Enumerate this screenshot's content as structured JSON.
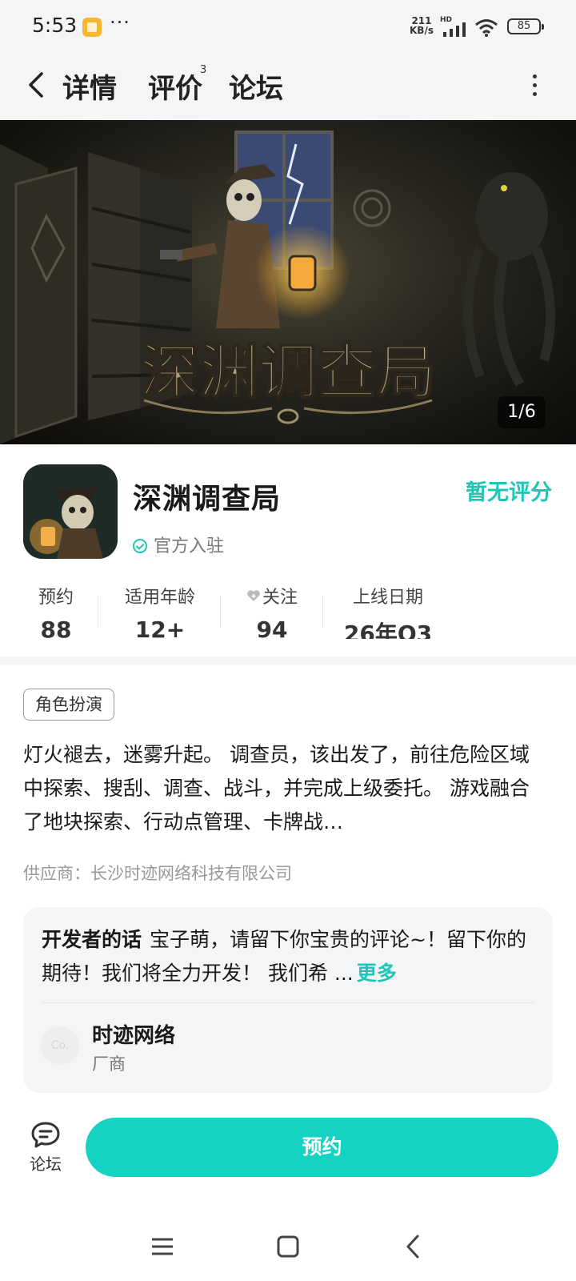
{
  "status_bar": {
    "time": "5:53",
    "dots": "···",
    "speed_value": "211",
    "speed_unit": "KB/s",
    "hd": "HD",
    "battery": "85"
  },
  "nav": {
    "tabs": [
      {
        "label": "详情",
        "active": true
      },
      {
        "label": "评价",
        "badge": "3"
      },
      {
        "label": "论坛"
      }
    ]
  },
  "banner": {
    "counter": "1/6",
    "art_title": "深渊调查局"
  },
  "game": {
    "title": "深渊调查局",
    "rating": "暂无评分",
    "verified_label": "官方入驻"
  },
  "stats": [
    {
      "label": "预约",
      "value": "88"
    },
    {
      "label": "适用年龄",
      "value": "12+"
    },
    {
      "label": "关注",
      "value": "94"
    },
    {
      "label": "上线日期",
      "value": "26年Q3"
    }
  ],
  "tag": "角色扮演",
  "description": "灯火褪去，迷雾升起。 调查员，该出发了，前往危险区域中探索、搜刮、调查、战斗，并完成上级委托。 游戏融合了地块探索、行动点管理、卡牌战…",
  "supplier": "供应商：长沙时迹网络科技有限公司",
  "developer": {
    "label": "开发者的话",
    "text": "宝子萌，请留下你宝贵的评论~！留下你的期待！我们将全力开发！ 我们希 ...",
    "more": "更多",
    "avatar_text": "Co.",
    "name": "时迹网络",
    "role": "厂商"
  },
  "bottom_bar": {
    "forum_label": "论坛",
    "reserve_label": "预约"
  },
  "colors": {
    "accent": "#15d3c3",
    "accent_text": "#1ec6b6",
    "page_bg": "#f4f5f7"
  }
}
